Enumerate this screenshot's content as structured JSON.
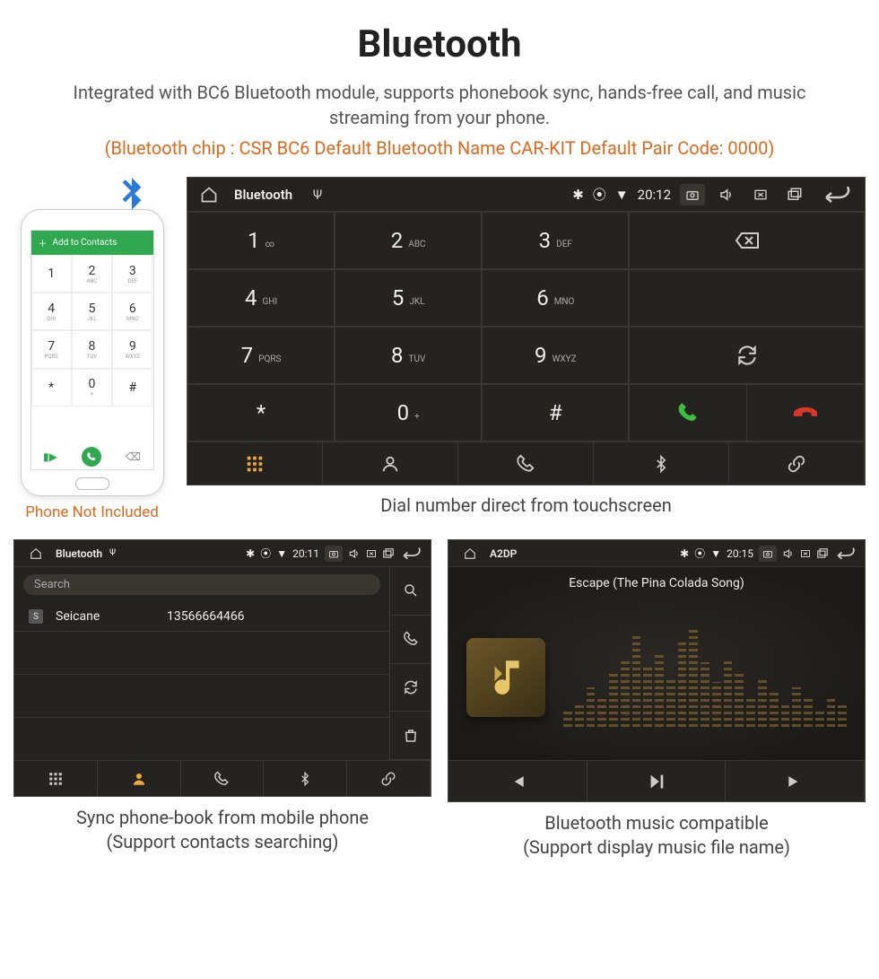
{
  "header": {
    "title": "Bluetooth",
    "intro": "Integrated with BC6 Bluetooth module, supports phonebook sync, hands-free call, and music streaming from your phone.",
    "specs": "(Bluetooth chip : CSR BC6     Default Bluetooth Name CAR-KIT     Default Pair Code: 0000)"
  },
  "phone": {
    "topbar_label": "Add to Contacts",
    "caption": "Phone Not Included",
    "keys": [
      {
        "d": "1",
        "s": ""
      },
      {
        "d": "2",
        "s": "ABC"
      },
      {
        "d": "3",
        "s": "DEF"
      },
      {
        "d": "4",
        "s": "GHI"
      },
      {
        "d": "5",
        "s": "JKL"
      },
      {
        "d": "6",
        "s": "MNO"
      },
      {
        "d": "7",
        "s": "PQRS"
      },
      {
        "d": "8",
        "s": "TUV"
      },
      {
        "d": "9",
        "s": "WXYZ"
      },
      {
        "d": "*",
        "s": ""
      },
      {
        "d": "0",
        "s": "+"
      },
      {
        "d": "#",
        "s": ""
      }
    ]
  },
  "dialer": {
    "title": "Bluetooth",
    "clock": "20:12",
    "keys": [
      {
        "d": "1",
        "s": "∞"
      },
      {
        "d": "2",
        "s": "ABC"
      },
      {
        "d": "3",
        "s": "DEF"
      },
      {
        "d": "4",
        "s": "GHI"
      },
      {
        "d": "5",
        "s": "JKL"
      },
      {
        "d": "6",
        "s": "MNO"
      },
      {
        "d": "7",
        "s": "PQRS"
      },
      {
        "d": "8",
        "s": "TUV"
      },
      {
        "d": "9",
        "s": "WXYZ"
      },
      {
        "d": "*",
        "s": ""
      },
      {
        "d": "0",
        "s": "+"
      },
      {
        "d": "#",
        "s": ""
      }
    ],
    "caption": "Dial number direct from touchscreen"
  },
  "contacts": {
    "title": "Bluetooth",
    "clock": "20:11",
    "search_placeholder": "Search",
    "list": [
      {
        "badge": "S",
        "name": "Seicane",
        "number": "13566664466"
      }
    ],
    "caption_line1": "Sync phone-book from mobile phone",
    "caption_line2": "(Support contacts searching)"
  },
  "a2dp": {
    "title": "A2DP",
    "clock": "20:15",
    "song": "Escape (The Pina Colada Song)",
    "caption_line1": "Bluetooth music compatible",
    "caption_line2": "(Support display music file name)"
  }
}
